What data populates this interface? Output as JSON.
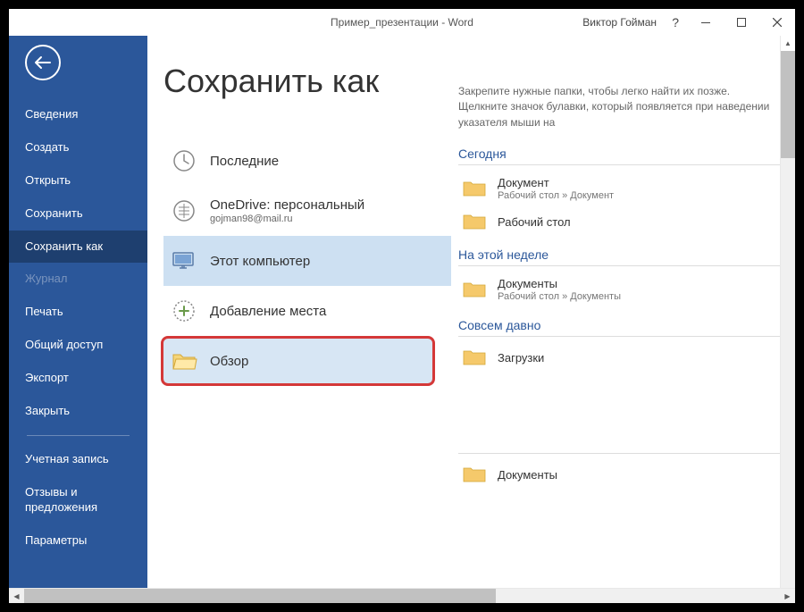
{
  "titlebar": {
    "title": "Пример_презентации - Word",
    "user": "Виктор Гойман"
  },
  "page_title": "Сохранить как",
  "nav": [
    "Сведения",
    "Создать",
    "Открыть",
    "Сохранить",
    "Сохранить как",
    "Журнал",
    "Печать",
    "Общий доступ",
    "Экспорт",
    "Закрыть",
    "Учетная запись",
    "Отзывы и предложения",
    "Параметры"
  ],
  "locations": {
    "recent": "Последние",
    "onedrive": {
      "label": "OneDrive: персональный",
      "sub": "gojman98@mail.ru"
    },
    "thispc": "Этот компьютер",
    "addplace": "Добавление места",
    "browse": "Обзор"
  },
  "right": {
    "hint": "Закрепите нужные папки, чтобы легко найти их позже. Щелкните значок булавки, который появляется при наведении указателя мыши на",
    "sections": [
      {
        "label": "Сегодня",
        "items": [
          {
            "name": "Документ",
            "path": "Рабочий стол » Документ"
          },
          {
            "name": "Рабочий стол",
            "path": ""
          }
        ]
      },
      {
        "label": "На этой неделе",
        "items": [
          {
            "name": "Документы",
            "path": "Рабочий стол » Документы"
          }
        ]
      },
      {
        "label": "Совсем давно",
        "items": [
          {
            "name": "Загрузки",
            "path": ""
          }
        ]
      }
    ],
    "bottom_item": {
      "name": "Документы",
      "path": ""
    }
  }
}
